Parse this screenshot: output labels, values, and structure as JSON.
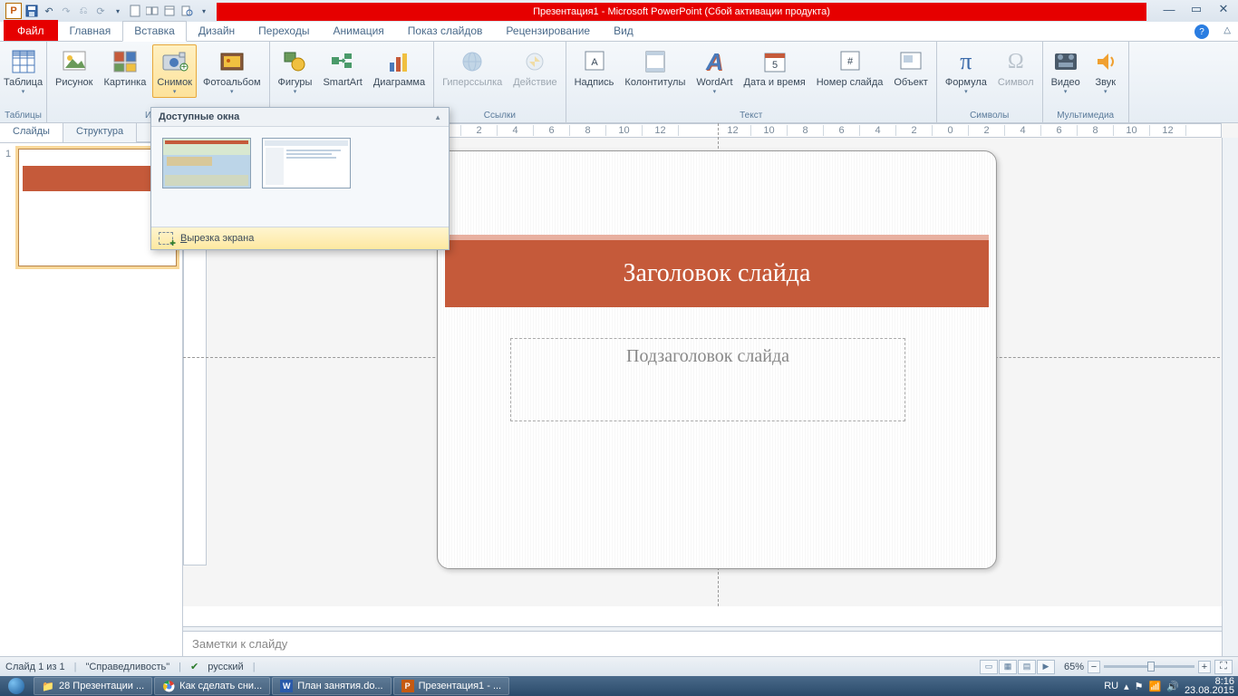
{
  "titlebar": {
    "title": "Презентация1 - Microsoft PowerPoint (Сбой активации продукта)"
  },
  "qat": {
    "save": "save",
    "undo": "undo",
    "redo": "redo"
  },
  "tabs": {
    "file": "Файл",
    "home": "Главная",
    "insert": "Вставка",
    "design": "Дизайн",
    "transitions": "Переходы",
    "animations": "Анимация",
    "slideshow": "Показ слайдов",
    "review": "Рецензирование",
    "view": "Вид"
  },
  "ribbon": {
    "groups": {
      "tables": "Таблицы",
      "images": "Изобр",
      "illustrations": "",
      "links": "Ссылки",
      "text": "Текст",
      "symbols": "Символы",
      "media": "Мультимедиа"
    },
    "table": "Таблица",
    "picture": "Рисунок",
    "clipart": "Картинка",
    "screenshot": "Снимок",
    "album": "Фотоальбом",
    "shapes": "Фигуры",
    "smartart": "SmartArt",
    "chart": "Диаграмма",
    "hyperlink": "Гиперссылка",
    "action": "Действие",
    "textbox": "Надпись",
    "headerfooter": "Колонтитулы",
    "wordart": "WordArt",
    "datetime": "Дата и время",
    "slidenum": "Номер слайда",
    "object": "Объект",
    "equation": "Формула",
    "symbol": "Символ",
    "video": "Видео",
    "audio": "Звук"
  },
  "popup": {
    "header": "Доступные окна",
    "clip": "Вырезка экрана",
    "clipkey": "В"
  },
  "side": {
    "slides": "Слайды",
    "outline": "Структура",
    "num": "1"
  },
  "slide": {
    "title": "Заголовок слайда",
    "subtitle": "Подзаголовок слайда"
  },
  "notes": "Заметки к слайду",
  "status": {
    "slide": "Слайд 1 из 1",
    "theme": "\"Справедливость\"",
    "lang": "русский",
    "zoom": "65%"
  },
  "taskbar": {
    "t1": "28 Презентации ...",
    "t2": "Как сделать сни...",
    "t3": "План занятия.do...",
    "t4": "Презентация1 - ...",
    "lang": "RU",
    "time": "8:16",
    "date": "23.08.2015"
  }
}
